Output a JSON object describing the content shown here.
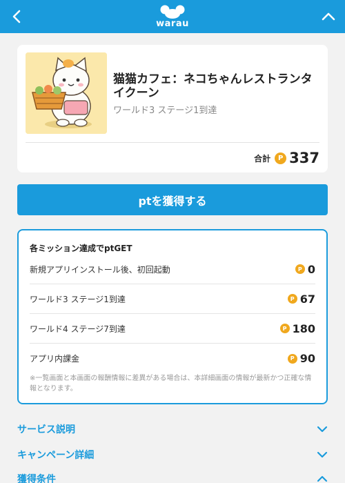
{
  "header": {
    "logo_text": "warau",
    "brand_color": "#1a9bdc"
  },
  "offer": {
    "title": "猫猫カフェ：ネコちゃんレストランタイクーン",
    "subtitle": "ワールド3 ステージ1到達",
    "total_label": "合計",
    "total_points": "337",
    "coin_symbol": "P"
  },
  "cta": {
    "label": "ptを獲得する"
  },
  "missions": {
    "heading": "各ミッション達成でptGET",
    "items": [
      {
        "label": "新規アプリインストール後、初回起動",
        "points": "0"
      },
      {
        "label": "ワールド3 ステージ1到達",
        "points": "67"
      },
      {
        "label": "ワールド4 ステージ7到達",
        "points": "180"
      },
      {
        "label": "アプリ内課金",
        "points": "90"
      }
    ],
    "note": "※一覧画面と本画面の報酬情報に差異がある場合は、本詳細画面の情報が最新かつ正確な情報となります。"
  },
  "accordions": [
    {
      "label": "サービス説明",
      "icon": "chevron-down-icon"
    },
    {
      "label": "キャンペーン詳細",
      "icon": "chevron-down-icon"
    },
    {
      "label": "獲得条件",
      "icon": "chevron-up-icon"
    }
  ]
}
